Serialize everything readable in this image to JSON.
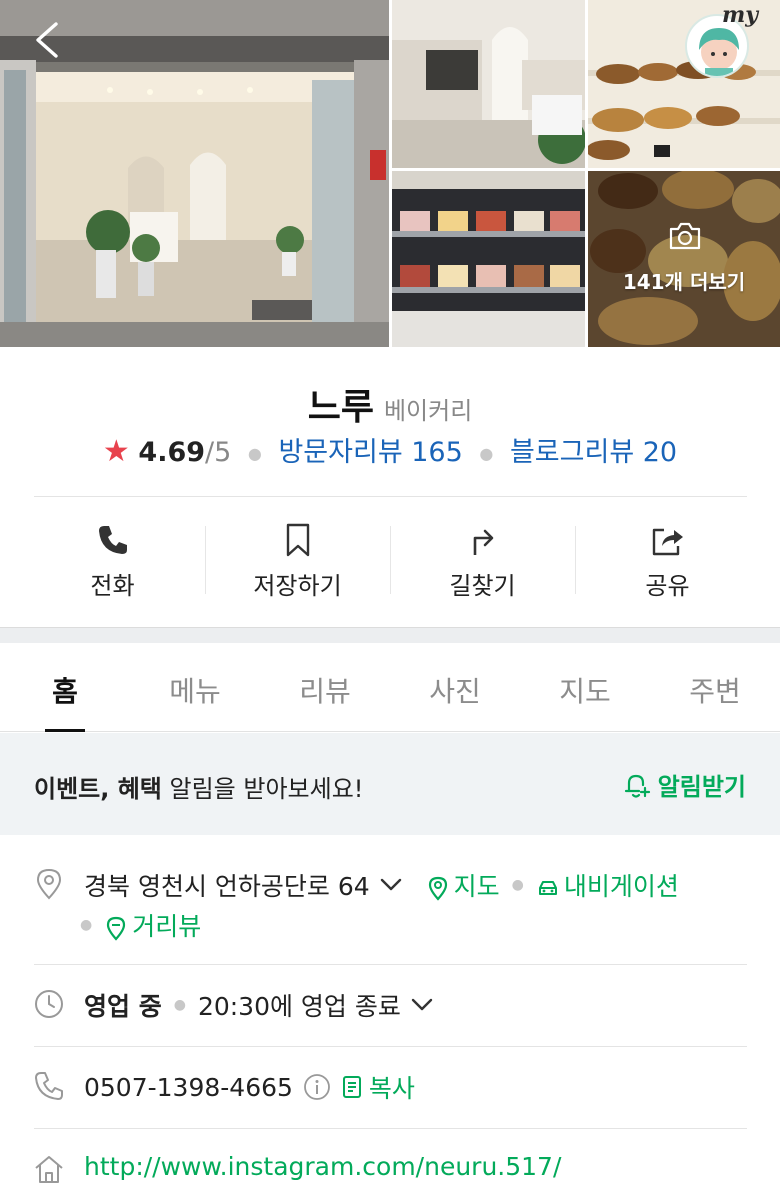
{
  "gallery": {
    "more_label": "141개 더보기",
    "avatar_label": "my"
  },
  "place": {
    "name": "느루",
    "category": "베이커리",
    "rating_star": "★",
    "rating": "4.69",
    "rating_scale": "/5",
    "visitor_reviews": "방문자리뷰 165",
    "blog_reviews": "블로그리뷰 20"
  },
  "actions": [
    {
      "label": "전화",
      "icon": "phone-icon"
    },
    {
      "label": "저장하기",
      "icon": "bookmark-icon"
    },
    {
      "label": "길찾기",
      "icon": "directions-icon"
    },
    {
      "label": "공유",
      "icon": "share-icon"
    }
  ],
  "tabs": [
    "홈",
    "메뉴",
    "리뷰",
    "사진",
    "지도",
    "주변"
  ],
  "active_tab": "홈",
  "notice": {
    "bold": "이벤트, 혜택",
    "text": " 알림을 받아보세요!",
    "button": "알림받기"
  },
  "info": {
    "address": "경북 영천시 언하공단로 64",
    "map_link": "지도",
    "navigation_link": "내비게이션",
    "street_view_link": "거리뷰",
    "status": "영업 중",
    "hours": "20:30에 영업 종료",
    "phone": "0507-1398-4665",
    "copy_label": "복사",
    "website": "http://www.instagram.com/neuru.517/"
  },
  "colors": {
    "accent_green": "#03aa5a",
    "link_blue": "#1a64b8",
    "star_red": "#e8424d"
  }
}
